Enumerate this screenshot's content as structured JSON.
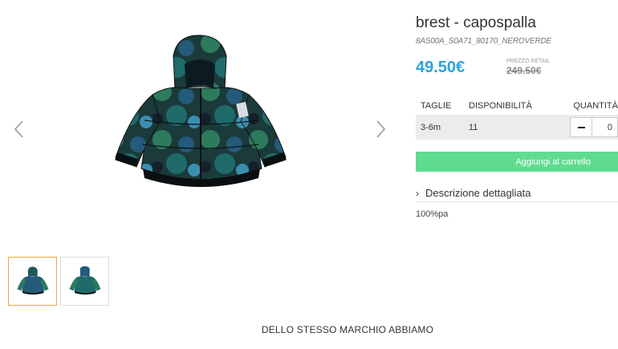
{
  "product": {
    "title": "brest - capospalla",
    "sku": "8AS00A_S0A71_80170_NEROVERDE",
    "price": "49.50€",
    "retail_label": "PREZZO RETAIL",
    "retail_price": "249.50€",
    "description_toggle": "Descrizione dettagliata",
    "description_text": "100%pa"
  },
  "sizes": {
    "headers": {
      "size": "TAGLIE",
      "availability": "DISPONIBILITÀ",
      "quantity": "QUANTITÀ"
    },
    "rows": [
      {
        "size": "3-6m",
        "availability": "11",
        "quantity": "0"
      }
    ]
  },
  "cart_button": "Aggiungi al carrello",
  "brand_heading": "DELLO STESSO MARCHIO ABBIAMO",
  "icons": {
    "prev": "chevron-left-icon",
    "next": "chevron-right-icon",
    "minus": "minus-icon",
    "desc": "chevron-right-icon"
  },
  "colors": {
    "price": "#2ea3dc",
    "cart_button": "#5fdc8f",
    "active_thumb_border": "#f2a73b"
  }
}
